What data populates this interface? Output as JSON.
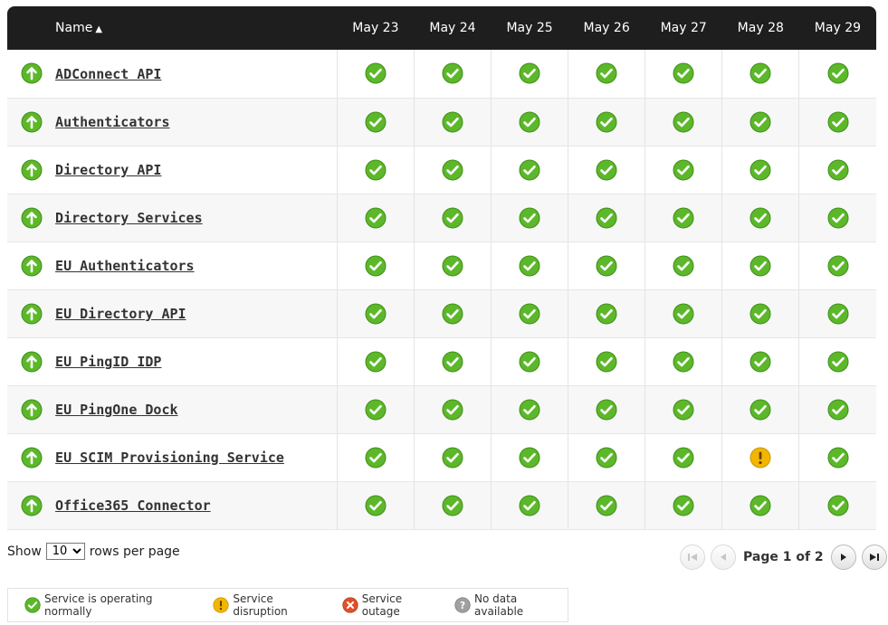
{
  "header": {
    "name_label": "Name",
    "sort_indicator": "▲",
    "days": [
      "May 23",
      "May 24",
      "May 25",
      "May 26",
      "May 27",
      "May 28",
      "May 29"
    ]
  },
  "icons": {
    "row_status": "arrow-up-icon",
    "normal": "check-circle-icon",
    "disruption": "exclamation-circle-icon",
    "outage": "x-circle-icon",
    "no_data": "question-circle-icon"
  },
  "colors": {
    "normal": "#5cb82a",
    "disruption": "#f2b600",
    "outage": "#e0502a",
    "no_data": "#a0a0a0",
    "header_bg": "#1e1e1e"
  },
  "services": [
    {
      "name": "ADConnect API",
      "statuses": [
        "normal",
        "normal",
        "normal",
        "normal",
        "normal",
        "normal",
        "normal"
      ]
    },
    {
      "name": "Authenticators",
      "statuses": [
        "normal",
        "normal",
        "normal",
        "normal",
        "normal",
        "normal",
        "normal"
      ]
    },
    {
      "name": "Directory API",
      "statuses": [
        "normal",
        "normal",
        "normal",
        "normal",
        "normal",
        "normal",
        "normal"
      ]
    },
    {
      "name": "Directory Services",
      "statuses": [
        "normal",
        "normal",
        "normal",
        "normal",
        "normal",
        "normal",
        "normal"
      ]
    },
    {
      "name": "EU Authenticators",
      "statuses": [
        "normal",
        "normal",
        "normal",
        "normal",
        "normal",
        "normal",
        "normal"
      ]
    },
    {
      "name": "EU Directory API",
      "statuses": [
        "normal",
        "normal",
        "normal",
        "normal",
        "normal",
        "normal",
        "normal"
      ]
    },
    {
      "name": "EU PingID IDP",
      "statuses": [
        "normal",
        "normal",
        "normal",
        "normal",
        "normal",
        "normal",
        "normal"
      ]
    },
    {
      "name": "EU PingOne Dock",
      "statuses": [
        "normal",
        "normal",
        "normal",
        "normal",
        "normal",
        "normal",
        "normal"
      ]
    },
    {
      "name": "EU SCIM Provisioning Service",
      "statuses": [
        "normal",
        "normal",
        "normal",
        "normal",
        "normal",
        "disruption",
        "normal"
      ]
    },
    {
      "name": "Office365 Connector",
      "statuses": [
        "normal",
        "normal",
        "normal",
        "normal",
        "normal",
        "normal",
        "normal"
      ]
    }
  ],
  "footer": {
    "show_label": "Show",
    "rows_value": "10",
    "rows_suffix": "rows per page",
    "page_text": "Page 1 of 2"
  },
  "legend": {
    "normal": "Service is operating normally",
    "disruption": "Service disruption",
    "outage": "Service outage",
    "no_data": "No data available"
  }
}
